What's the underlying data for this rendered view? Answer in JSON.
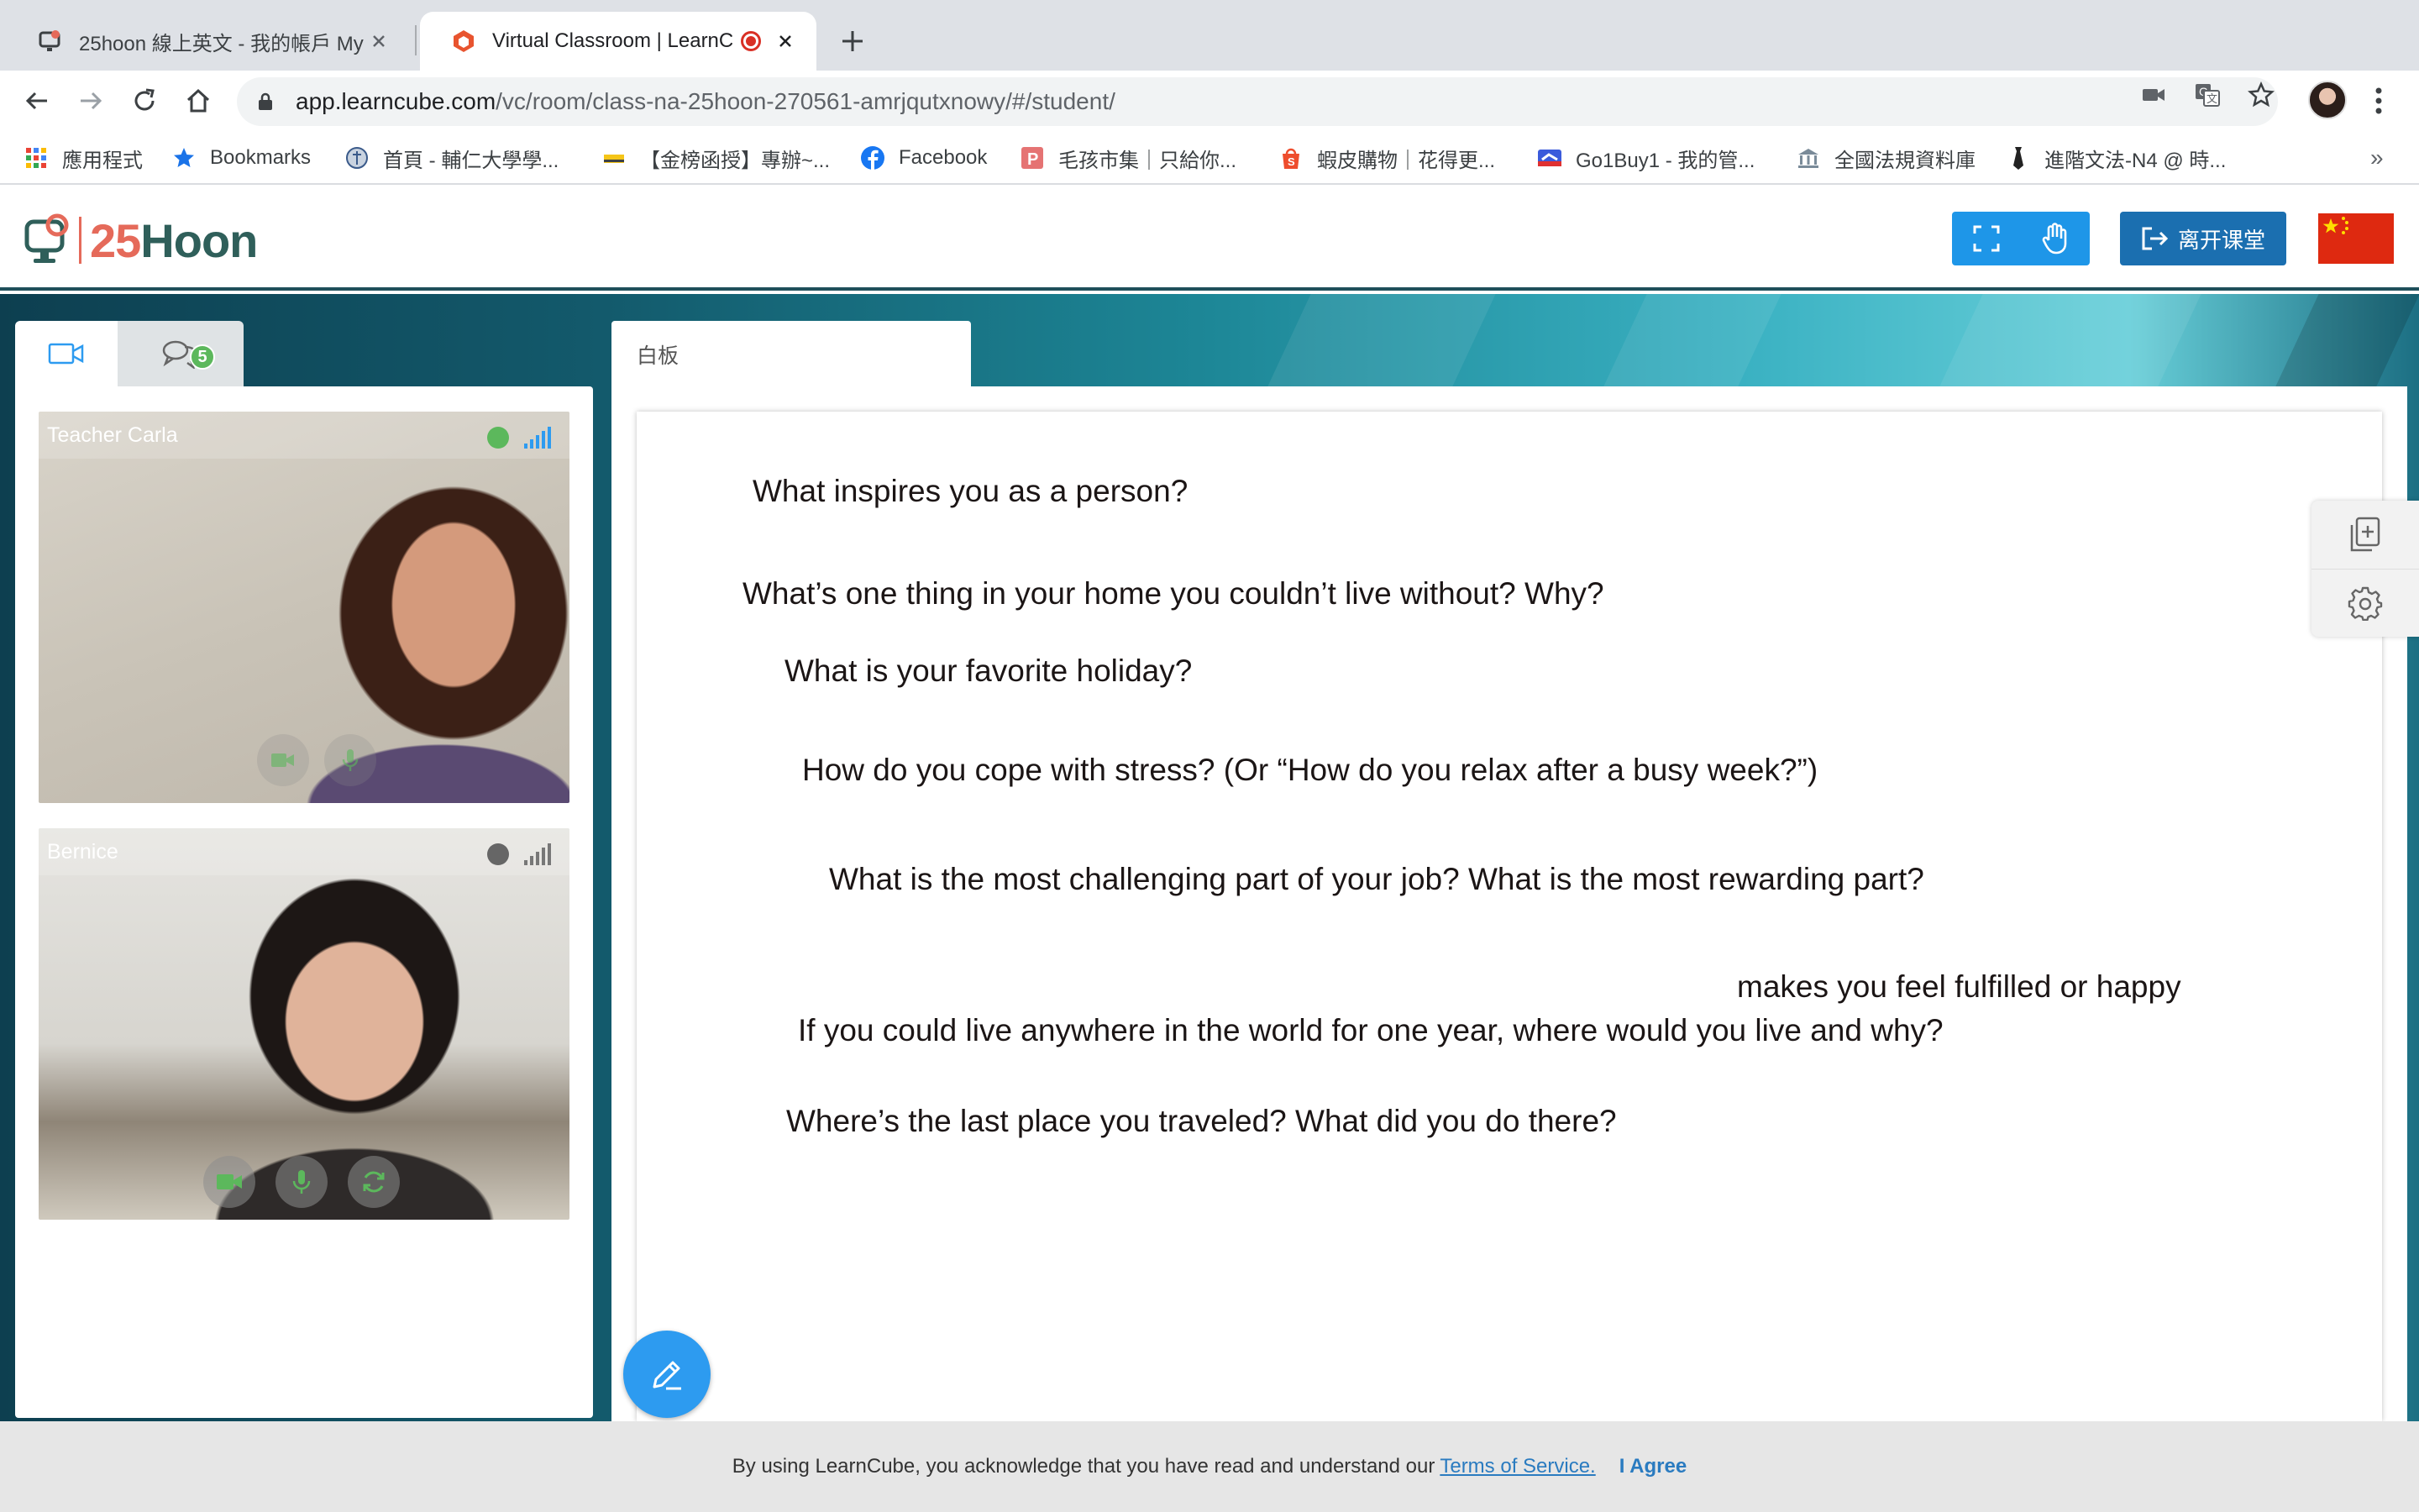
{
  "browser": {
    "tabs": [
      {
        "title": "25hoon 線上英文 - 我的帳戶 My",
        "active": false
      },
      {
        "title": "Virtual Classroom | LearnC",
        "active": true,
        "recording": true
      }
    ],
    "url_host": "app.learncube.com",
    "url_path": "/vc/room/class-na-25hoon-270561-amrjqutxnowy/#/student/",
    "bookmarks": [
      {
        "label": "應用程式",
        "icon": "apps-grid-icon"
      },
      {
        "label": "Bookmarks",
        "icon": "star-icon"
      },
      {
        "label": "首頁 - 輔仁大學學...",
        "icon": "university-icon"
      },
      {
        "label": "【金榜函授】專辦~...",
        "icon": "book-icon"
      },
      {
        "label": "Facebook",
        "icon": "facebook-icon"
      },
      {
        "label": "毛孩市集｜只給你...",
        "icon": "p-icon"
      },
      {
        "label": "蝦皮購物｜花得更...",
        "icon": "shopee-icon"
      },
      {
        "label": "Go1Buy1 - 我的管...",
        "icon": "go1buy1-icon"
      },
      {
        "label": "全國法規資料庫",
        "icon": "law-icon"
      },
      {
        "label": "進階文法-N4 @ 時...",
        "icon": "tie-icon"
      }
    ],
    "bookmarks_overflow": "»"
  },
  "app": {
    "logo_number": "25",
    "logo_word": "Hoon",
    "leave_label": "离开课堂",
    "colors": {
      "primary": "#1e96e8",
      "leave": "#1b6fb0",
      "brand_coral": "#e56a5a",
      "brand_green": "#2f5f5a"
    }
  },
  "sidebar": {
    "chat_badge": "5",
    "participants": [
      {
        "name": "Teacher Carla",
        "status_color": "#5cb85c"
      },
      {
        "name": "Bernice",
        "status_color": "#666666"
      }
    ]
  },
  "whiteboard": {
    "tab_label": "白板",
    "questions": [
      "What inspires you as a person?",
      "What’s one thing in your home you couldn’t live without? Why?",
      "What is your favorite holiday?",
      "How do you cope with stress? (Or “How do you relax after a busy week?”)",
      "What is the most challenging part of your job? What is the most rewarding part?",
      "makes you feel fulfilled or happy",
      "If you could live anywhere in the world for one year, where would you live and why?",
      "Where’s the last place you traveled? What did you do there?"
    ]
  },
  "cookie_banner": {
    "text": "By using LearnCube, you acknowledge that you have read and understand our",
    "link": "Terms of Service.",
    "agree": "I Agree"
  }
}
